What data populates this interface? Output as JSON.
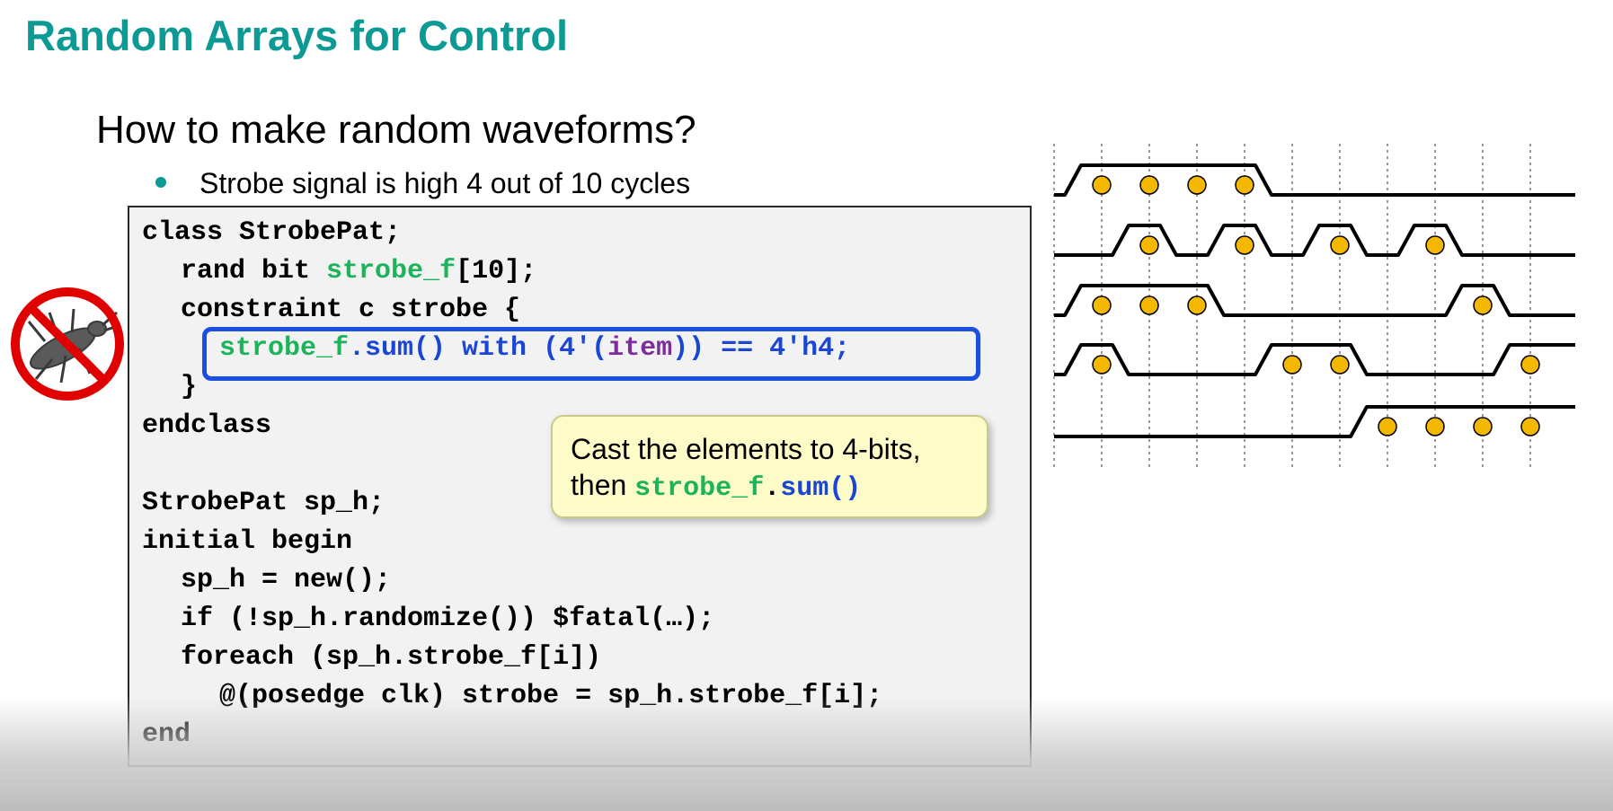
{
  "title": "Random Arrays for Control",
  "heading": "How to make random waveforms?",
  "bullet": "Strobe signal is high 4 out of 10 cycles",
  "code": {
    "l1": "class StrobePat;",
    "l2_pre": "rand bit ",
    "l2_var": "strobe_f",
    "l2_post": "[10];",
    "l3": "constraint c strobe {",
    "l4_var": "strobe_f",
    "l4_method": ".sum() with (4'(",
    "l4_item": "item",
    "l4_post": ")) == 4'h4;",
    "l5": "}",
    "l6": "endclass",
    "l7": "StrobePat sp_h;",
    "l8": "initial begin",
    "l9": "sp_h = new();",
    "l10": "if (!sp_h.randomize()) $fatal(…);",
    "l11": "foreach (sp_h.strobe_f[i])",
    "l12": "@(posedge clk) strobe = sp_h.strobe_f[i];",
    "l13": "end"
  },
  "callout": {
    "line1": "Cast the elements to 4-bits,",
    "line2_pre": "then ",
    "line2_var": "strobe_f",
    "line2_dot": ".",
    "line2_method": "sum()"
  },
  "icons": {
    "no_bug": "no-bug-icon"
  },
  "waveforms": {
    "cycles": 10,
    "rows": [
      [
        1,
        1,
        1,
        1,
        0,
        0,
        0,
        0,
        0,
        0
      ],
      [
        0,
        1,
        0,
        1,
        0,
        1,
        0,
        1,
        0,
        0
      ],
      [
        1,
        1,
        1,
        0,
        0,
        0,
        0,
        0,
        1,
        0
      ],
      [
        1,
        0,
        0,
        0,
        1,
        1,
        0,
        0,
        0,
        1
      ],
      [
        0,
        0,
        0,
        0,
        0,
        0,
        1,
        1,
        1,
        1
      ]
    ]
  },
  "colors": {
    "title": "#0e9a94",
    "code_var": "#1db35a",
    "code_keyword": "#1a45d6",
    "code_item": "#7b2d9b",
    "highlight": "#1a4fe0",
    "dot_fill": "#f5b800"
  }
}
